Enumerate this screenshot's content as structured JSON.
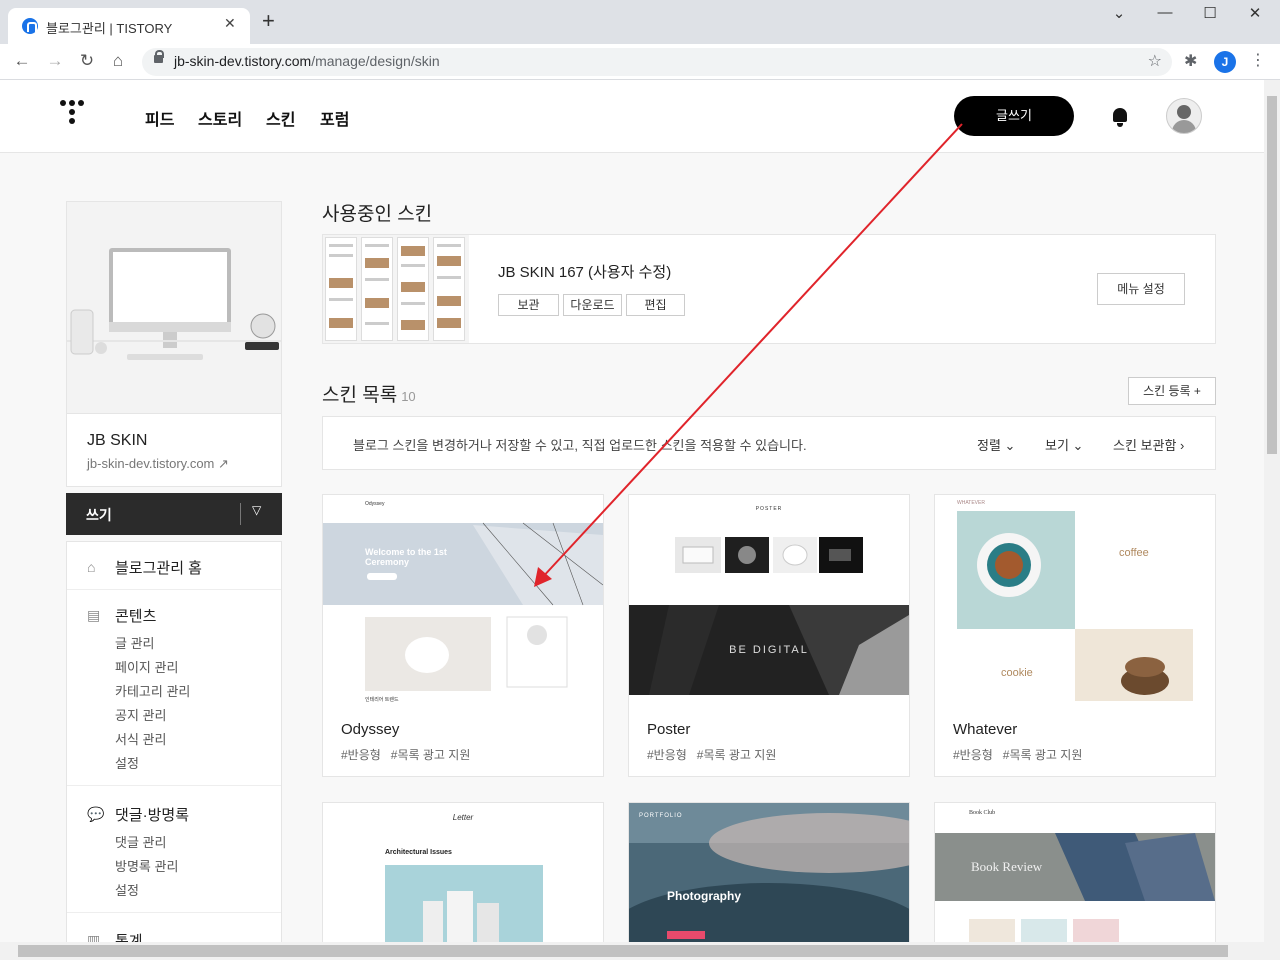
{
  "browser": {
    "tab_title": "블로그관리 | TISTORY",
    "url_host": "jb-skin-dev.tistory.com",
    "url_path": "/manage/design/skin",
    "profile_initial": "J"
  },
  "header": {
    "nav": [
      "피드",
      "스토리",
      "스킨",
      "포럼"
    ],
    "write_label": "글쓰기"
  },
  "sidebar": {
    "blog_name": "JB SKIN",
    "blog_url": "jb-skin-dev.tistory.com",
    "write_label": "쓰기",
    "home_label": "블로그관리 홈",
    "contents_label": "콘텐츠",
    "contents_items": [
      "글 관리",
      "페이지 관리",
      "카테고리 관리",
      "공지 관리",
      "서식 관리",
      "설정"
    ],
    "comments_label": "댓글·방명록",
    "comments_items": [
      "댓글 관리",
      "방명록 관리",
      "설정"
    ],
    "stats_label": "통계"
  },
  "current_skin": {
    "section_title": "사용중인 스킨",
    "name": "JB SKIN 167 (사용자 수정)",
    "buttons": [
      "보관",
      "다운로드",
      "편집"
    ],
    "menu_settings": "메뉴 설정"
  },
  "skin_list": {
    "section_title": "스킨 목록",
    "count": "10",
    "register_label": "스킨 등록 +",
    "info": "블로그 스킨을 변경하거나 저장할 수 있고, 직접 업로드한 스킨을 적용할 수 있습니다.",
    "sort_label": "정렬",
    "view_label": "보기",
    "storage_label": "스킨 보관함",
    "cards": [
      {
        "name": "Odyssey",
        "tags": [
          "#반응형",
          "#목록 광고 지원"
        ],
        "thumb_text": "Welcome to the 1st Ceremony",
        "thumb_title": "Odyssey",
        "thumb_caption": "인테리어 트렌드"
      },
      {
        "name": "Poster",
        "tags": [
          "#반응형",
          "#목록 광고 지원"
        ],
        "thumb_text": "BE DIGITAL",
        "thumb_title": "POSTER"
      },
      {
        "name": "Whatever",
        "tags": [
          "#반응형",
          "#목록 광고 지원"
        ],
        "thumb_title": "WHATEVER",
        "thumb_word1": "coffee",
        "thumb_word2": "cookie"
      }
    ],
    "cards_row2": [
      {
        "thumb_title": "Letter",
        "thumb_text": "Architectural Issues"
      },
      {
        "thumb_title": "PORTFOLIO",
        "thumb_text": "Photography"
      },
      {
        "thumb_title": "Book Club",
        "thumb_text": "Book Review"
      }
    ]
  },
  "colors": {
    "accent": "#000000",
    "annotation_arrow": "#e0242b",
    "chrome": "#dee1e6"
  }
}
